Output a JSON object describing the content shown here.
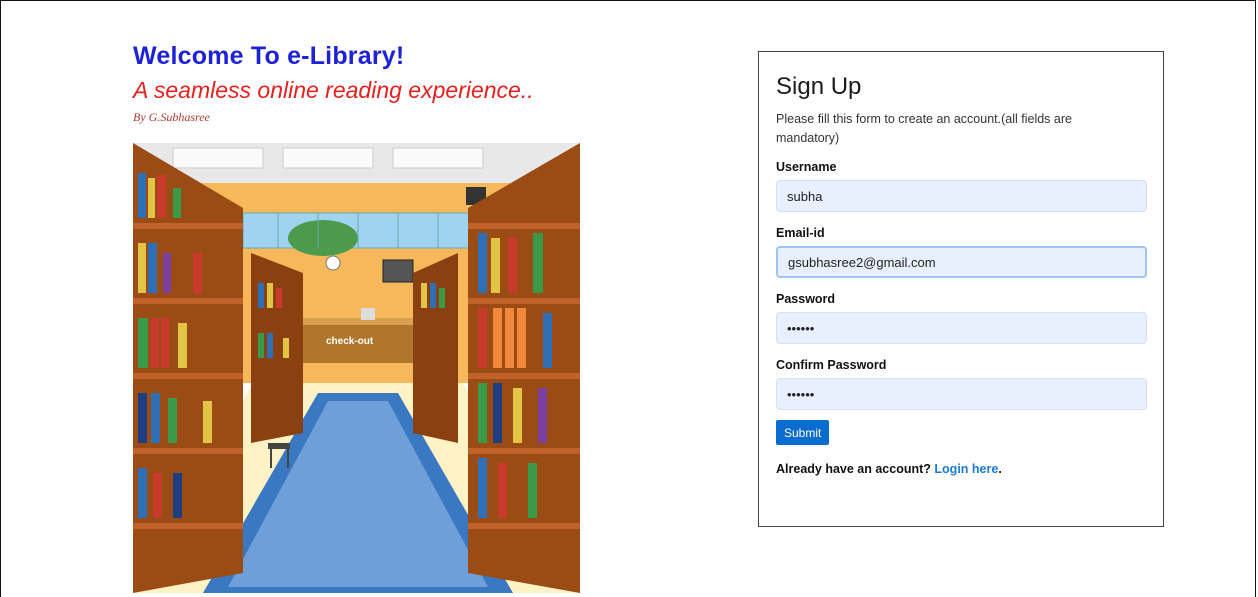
{
  "hero": {
    "welcome": "Welcome To e-Library!",
    "tagline": "A seamless online reading experience..",
    "byline": "By G.Subhasree",
    "illustration_label": "check-out"
  },
  "form": {
    "title": "Sign Up",
    "intro": "Please fill this form to create an account.(all fields are mandatory)",
    "username_label": "Username",
    "username_value": "subha",
    "email_label": "Email-id",
    "email_value": "gsubhasree2@gmail.com",
    "password_label": "Password",
    "password_value": "••••••",
    "confirm_label": "Confirm Password",
    "confirm_value": "••••••",
    "submit_label": "Submit",
    "login_prompt": "Already have an account?",
    "login_link": "Login here",
    "login_suffix": "."
  },
  "colors": {
    "accent": "#0a6ccf",
    "heading": "#1d22d6",
    "tagline": "#e8201e",
    "link": "#1a7bd6"
  }
}
